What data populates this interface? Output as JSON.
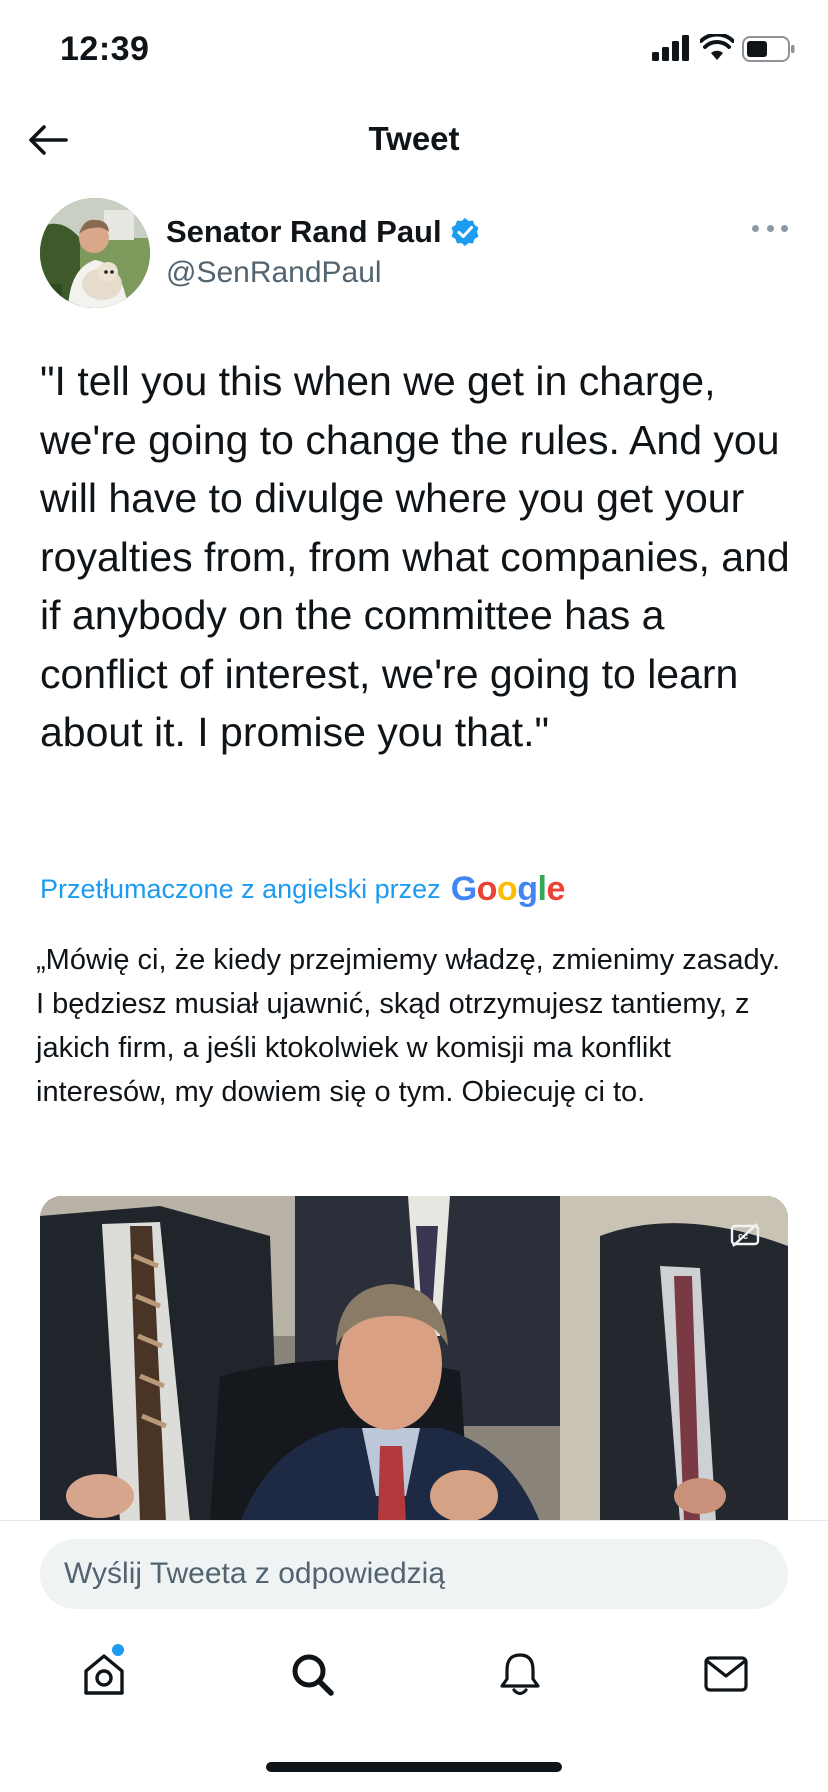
{
  "status_bar": {
    "time": "12:39"
  },
  "header": {
    "title": "Tweet"
  },
  "tweet": {
    "author_name": "Senator Rand Paul",
    "author_handle": "@SenRandPaul",
    "text": "\"I tell you this when we get in charge, we're going to change the rules. And you will have to divulge where you get your royalties from, from what companies, and if anybody on the committee has a conflict of interest, we're going to learn about it. I promise you that.\"",
    "translation_label": "Przetłumaczone z angielski przez",
    "translation_provider": "Google",
    "translated_text": "„Mówię ci, że kiedy przejmiemy władzę, zmienimy zasady. I będziesz musiał ujawnić, skąd otrzymujesz tantiemy, z jakich firm, a jeśli ktokolwiek w komisji ma konflikt interesów, my dowiem się o tym. Obiecuję ci to.",
    "media_icon": "closed-captions-icon"
  },
  "reply": {
    "placeholder": "Wyślij Tweeta z odpowiedzią"
  },
  "tabs": [
    {
      "icon": "home-icon",
      "has_badge": true
    },
    {
      "icon": "search-icon"
    },
    {
      "icon": "bell-icon"
    },
    {
      "icon": "mail-icon"
    }
  ],
  "colors": {
    "accent": "#1d9bf0",
    "text_primary": "#0f1419",
    "text_secondary": "#536471",
    "google_blue": "#4285f4",
    "google_red": "#ea4335",
    "google_yellow": "#fbbc05",
    "google_green": "#34a853"
  }
}
